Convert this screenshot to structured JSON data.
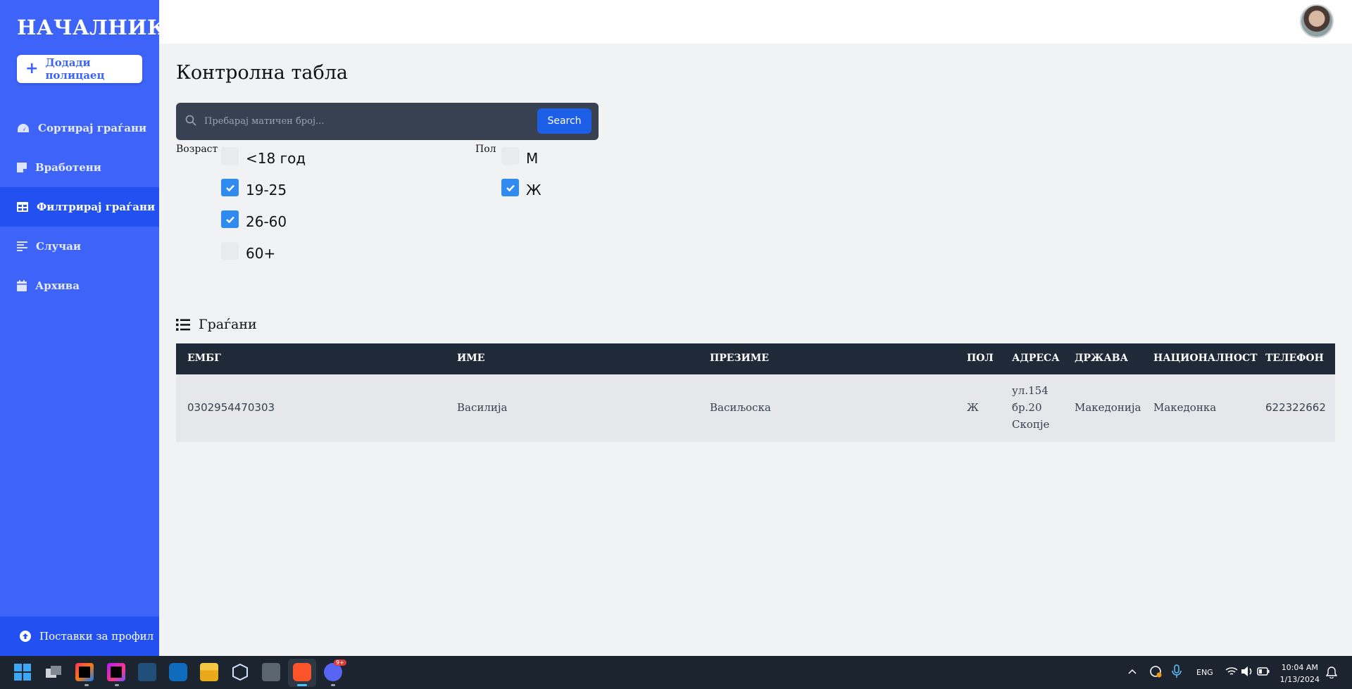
{
  "brand": "НАЧАЛНИК",
  "add_button": "Додади полицаец",
  "nav": [
    {
      "label": "Сортирај граѓани",
      "icon": "dashboard-icon",
      "active": false
    },
    {
      "label": "Вработени",
      "icon": "note-icon",
      "active": false
    },
    {
      "label": "Филтрирај граѓани",
      "icon": "table-icon",
      "active": true
    },
    {
      "label": "Случаи",
      "icon": "align-left-icon",
      "active": false
    },
    {
      "label": "Архива",
      "icon": "calendar-icon",
      "active": false
    }
  ],
  "profile_link": "Поставки за профил",
  "page_title": "Контролна табла",
  "search": {
    "placeholder": "Пребарај матичен број...",
    "value": "",
    "button": "Search"
  },
  "filters": {
    "age": {
      "label": "Возраст",
      "options": [
        {
          "label": "<18 год",
          "checked": false
        },
        {
          "label": "19-25",
          "checked": true
        },
        {
          "label": "26-60",
          "checked": true
        },
        {
          "label": "60+",
          "checked": false
        }
      ]
    },
    "gender": {
      "label": "Пол",
      "options": [
        {
          "label": "М",
          "checked": false
        },
        {
          "label": "Ж",
          "checked": true
        }
      ]
    }
  },
  "citizens": {
    "title": "Граѓани",
    "columns": [
      "ЕМБГ",
      "ИМЕ",
      "ПРЕЗИМЕ",
      "ПОЛ",
      "АДРЕСА",
      "ДРЖАВА",
      "НАЦИОНАЛНОСТ",
      "ТЕЛЕФОН"
    ],
    "rows": [
      {
        "embg": "0302954470303",
        "name": "Василија",
        "surname": "Васиљоска",
        "gender": "Ж",
        "address": [
          "ул.154",
          "бр.20",
          "Скопје"
        ],
        "country": "Македонија",
        "nationality": "Македонка",
        "phone": "622322662"
      }
    ]
  },
  "taskbar": {
    "apps": [
      "windows-start-icon",
      "task-view-icon",
      "intellij-icon",
      "phpstorm-icon",
      "mysql-workbench-icon",
      "outlook-icon",
      "file-explorer-icon",
      "virtualbox-icon",
      "calculator-icon",
      "brave-browser-icon",
      "discord-icon"
    ],
    "discord_badge": "9+",
    "language": "ENG",
    "time": "10:04 AM",
    "date": "1/13/2024"
  },
  "colors": {
    "sidebar": "#3d63f9",
    "sidebar_active": "#2350f1",
    "table_header": "#1f2937",
    "accent": "#1d5ee6"
  }
}
